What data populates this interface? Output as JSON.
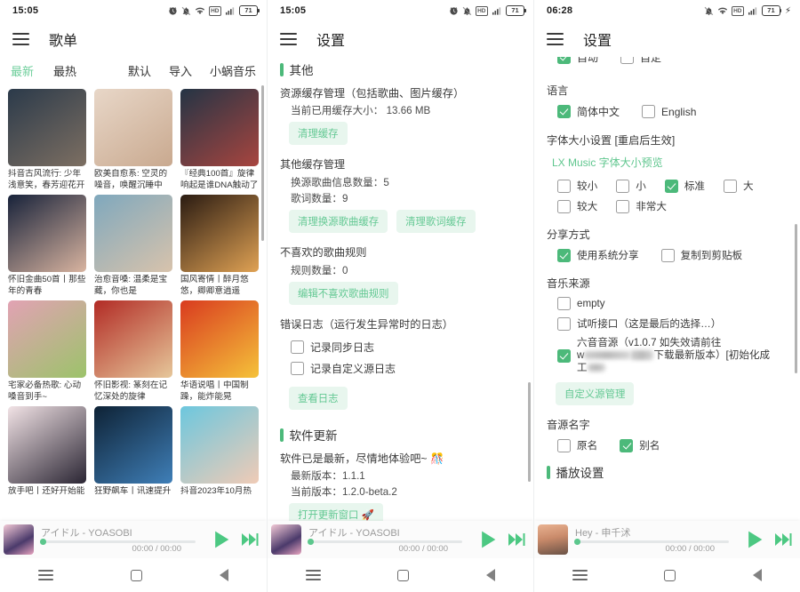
{
  "panel1": {
    "status": {
      "time": "15:05",
      "battery": "71",
      "icons": [
        "alarm-icon",
        "mute-bell-icon",
        "wifi-icon",
        "hd-icon",
        "signal-icon",
        "battery-icon"
      ]
    },
    "appbar": {
      "menu_icon": "hamburger-icon",
      "title": "歌单"
    },
    "tabs_left": [
      {
        "label": "最新",
        "active": true
      },
      {
        "label": "最热",
        "active": false
      }
    ],
    "tabs_right": [
      {
        "label": "默认"
      },
      {
        "label": "导入"
      },
      {
        "label": "小蜗音乐"
      }
    ],
    "cards": [
      {
        "title": "抖音古风流行: 少年浅意笑，春芳迎花开",
        "c1": "#2b3a4a",
        "c2": "#7d6f62"
      },
      {
        "title": "欧美自愈系: 空灵的噪音，唤醒沉睡中",
        "c1": "#e8d7c8",
        "c2": "#c9a98f"
      },
      {
        "title": "『经典100首』旋律响起是谁DNA触动了",
        "c1": "#243445",
        "c2": "#a8453f"
      },
      {
        "title": "怀旧金曲50首丨那些年的青春",
        "c1": "#17223a",
        "c2": "#d9b4a0"
      },
      {
        "title": "治愈音嗓: 温柔是宝藏，你也是",
        "c1": "#7fa8bd",
        "c2": "#d8c3ac"
      },
      {
        "title": "国风寄情丨醉月悠悠，卿卿意逍遥",
        "c1": "#2a1b12",
        "c2": "#e0a254"
      },
      {
        "title": "宅家必备热歌: 心动嗓音到手~",
        "c1": "#e2a2b4",
        "c2": "#9cc36a"
      },
      {
        "title": "怀旧影视: 篆刻在记忆深处的旋律",
        "c1": "#b22b25",
        "c2": "#e6c79a"
      },
      {
        "title": "华语说唱丨中国制躁，能炸能晃",
        "c1": "#d93b1f",
        "c2": "#f5c23a"
      },
      {
        "title": "放手吧丨还好开始能",
        "c1": "#f2e3e6",
        "c2": "#2a2533"
      },
      {
        "title": "狂野飙车丨讯速提升",
        "c1": "#0e2235",
        "c2": "#3f7fb8"
      },
      {
        "title": "抖音2023年10月热",
        "c1": "#6cc7de",
        "c2": "#f0cbb6"
      }
    ],
    "player": {
      "title": "アイドル - YOASOBI",
      "time": "00:00 / 00:00",
      "play_icon": "play-icon",
      "next_icon": "next-track-icon"
    },
    "nav": {
      "recents": "recents-icon",
      "home": "home-icon",
      "back": "back-icon"
    }
  },
  "panel2": {
    "status": {
      "time": "15:05",
      "battery": "71"
    },
    "appbar": {
      "title": "设置"
    },
    "section_other": "其他",
    "cache_title": "资源缓存管理（包括歌曲、图片缓存）",
    "cache_used_label": "当前已用缓存大小：",
    "cache_used_value": "13.66 MB",
    "clear_cache_btn": "清理缓存",
    "other_cache_title": "其他缓存管理",
    "switch_src_count": "换源歌曲信息数量：5",
    "lyric_count": "歌词数量：9",
    "clear_switch_btn": "清理换源歌曲缓存",
    "clear_lyric_btn": "清理歌词缓存",
    "dislike_title": "不喜欢的歌曲规则",
    "rule_count": "规则数量：0",
    "edit_rule_btn": "编辑不喜欢歌曲规则",
    "errlog_title": "错误日志（运行发生异常时的日志）",
    "cb_sync_log": {
      "label": "记录同步日志",
      "checked": false
    },
    "cb_custom_log": {
      "label": "记录自定义源日志",
      "checked": false
    },
    "view_log_btn": "查看日志",
    "section_update": "软件更新",
    "update_status": "软件已是最新，尽情地体验吧~ 🎊",
    "latest_version": "最新版本：1.1.1",
    "current_version": "当前版本：1.2.0-beta.2",
    "open_update_btn": "打开更新窗口 🚀",
    "player": {
      "title": "アイドル - YOASOBI",
      "time": "00:00 / 00:00"
    }
  },
  "panel3": {
    "status": {
      "time": "06:28",
      "battery": "71"
    },
    "appbar": {
      "title": "设置"
    },
    "partial_top": [
      {
        "label": "",
        "checked": true
      },
      {
        "label": "",
        "checked": false
      }
    ],
    "lang_title": "语言",
    "lang_options": [
      {
        "label": "简体中文",
        "checked": true
      },
      {
        "label": "English",
        "checked": false
      }
    ],
    "font_title": "字体大小设置 [重启后生效]",
    "font_preview_link": "LX Music 字体大小预览",
    "font_options": [
      {
        "label": "较小",
        "checked": false
      },
      {
        "label": "小",
        "checked": false
      },
      {
        "label": "标准",
        "checked": true
      },
      {
        "label": "大",
        "checked": false
      },
      {
        "label": "较大",
        "checked": false
      },
      {
        "label": "非常大",
        "checked": false
      }
    ],
    "share_title": "分享方式",
    "share_options": [
      {
        "label": "使用系统分享",
        "checked": true
      },
      {
        "label": "复制到剪贴板",
        "checked": false
      }
    ],
    "source_title": "音乐来源",
    "source_options": [
      {
        "label": "empty",
        "checked": false
      },
      {
        "label": "试听接口（这是最后的选择…）",
        "checked": false
      }
    ],
    "source_custom": {
      "checked": true,
      "line1": "六音音源（v1.0.7 如失效请前往",
      "line2_prefix": "w",
      "line2_suffix": "下载最新版本）[初始化成",
      "line3": "工"
    },
    "custom_source_btn": "自定义源管理",
    "source_name_title": "音源名字",
    "source_name_options": [
      {
        "label": "原名",
        "checked": false
      },
      {
        "label": "别名",
        "checked": true
      }
    ],
    "play_section": "播放设置",
    "player": {
      "title": "Hey - 申千沭",
      "time": "00:00 / 00:00"
    }
  },
  "theme": {
    "accent": "#4cb97a",
    "accent_light": "#e8f6ee",
    "accent_text": "#63c893",
    "player_green": "#4cc882"
  }
}
